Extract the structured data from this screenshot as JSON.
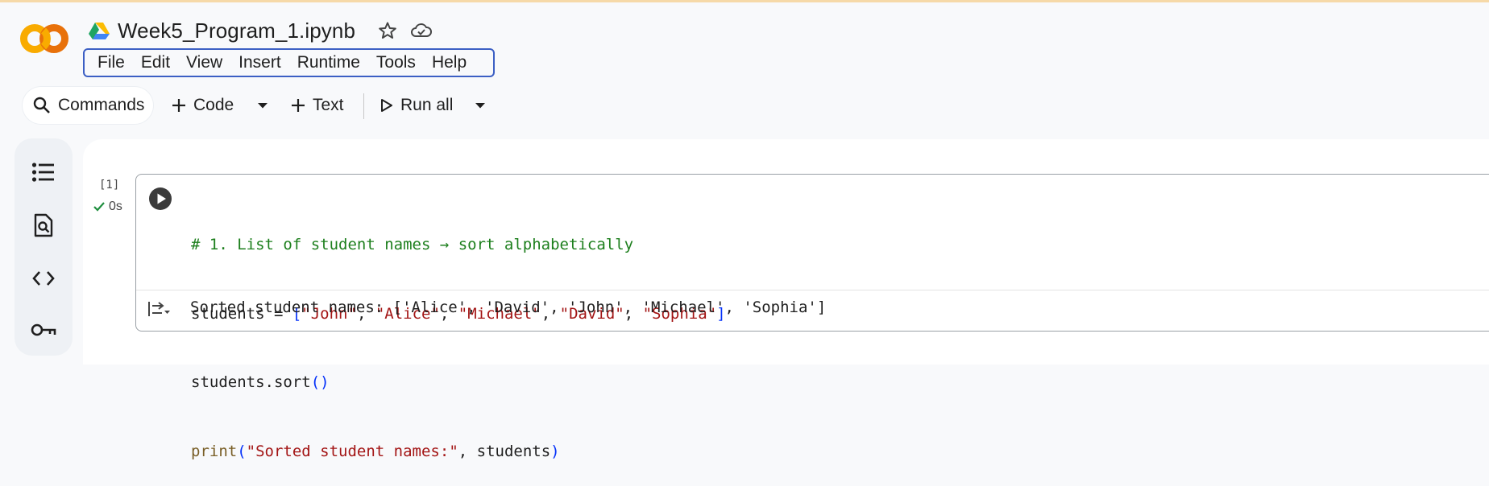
{
  "notebook": {
    "title": "Week5_Program_1.ipynb"
  },
  "menu": [
    "File",
    "Edit",
    "View",
    "Insert",
    "Runtime",
    "Tools",
    "Help"
  ],
  "toolbar": {
    "commands_label": "Commands",
    "code_label": "Code",
    "text_label": "Text",
    "run_all_label": "Run all"
  },
  "cell": {
    "exec_count": "[1]",
    "exec_time": "0s",
    "code_lines": [
      "# 1. List of student names → sort alphabetically",
      "students = [\"John\", \"Alice\", \"Michael\", \"David\", \"Sophia\"]",
      "students.sort()",
      "print(\"Sorted student names:\", students)"
    ],
    "output": "Sorted student names: ['Alice', 'David', 'John', 'Michael', 'Sophia']"
  },
  "icons": {
    "logo": "colab-logo",
    "drive": "google-drive-icon",
    "star": "star-icon",
    "cloud": "cloud-saved-icon",
    "sidebar": [
      "table-of-contents-icon",
      "find-replace-icon",
      "code-snippets-icon",
      "secrets-key-icon"
    ]
  },
  "colors": {
    "logo_orange": "#f9ab00",
    "accent_border": "#3c5fc4",
    "comment": "#1d7f1d",
    "string": "#a31515"
  }
}
